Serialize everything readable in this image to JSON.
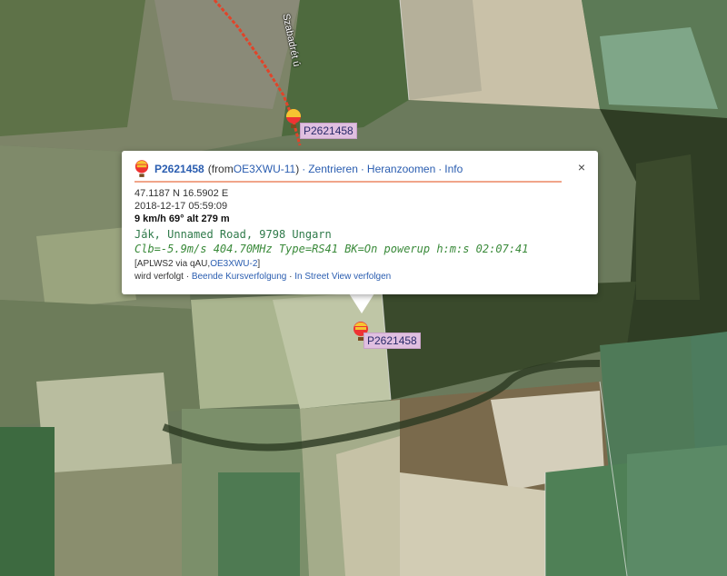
{
  "map": {
    "street": "Szabadrét ú",
    "track_color": "#e0442a",
    "markers": [
      {
        "label": "P2621458",
        "icon": "hot-air-balloon-icon"
      },
      {
        "label": "P2621458",
        "icon": "hot-air-balloon-icon"
      }
    ]
  },
  "popup": {
    "callsign": "P2621458",
    "from_prefix": "(from ",
    "from_station": "OE3XWU-11",
    "from_suffix": ")",
    "actions": [
      "Zentrieren",
      "Heranzoomen",
      "Info"
    ],
    "close": "×",
    "position": "47.1187 N 16.5902 E",
    "timestamp": "2018-12-17 05:59:09",
    "speed_line": "9 km/h 69° alt 279 m",
    "address": "Ják, Unnamed Road, 9798 Ungarn",
    "comment": "Clb=-5.9m/s 404.70MHz Type=RS41 BK=On powerup h:m:s 02:07:41",
    "path_prefix": "[APLWS2 via qAU,",
    "path_station": "OE3XWU-2",
    "path_suffix": "]",
    "follow_label": "wird verfolgt",
    "follow_links": [
      "Beende Kursverfolgung",
      "In Street View verfolgen"
    ]
  }
}
